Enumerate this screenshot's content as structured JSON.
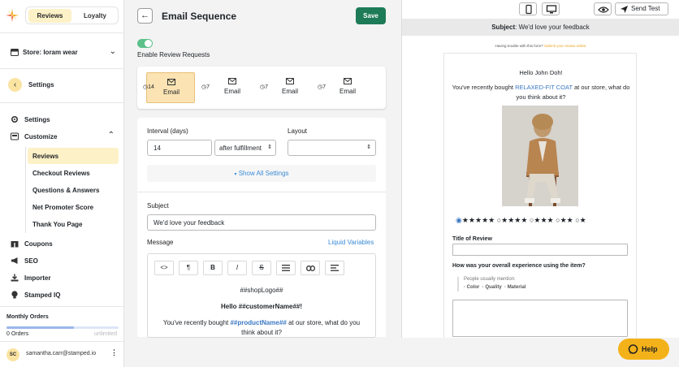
{
  "sidebar": {
    "tabs": [
      {
        "label": "Reviews"
      },
      {
        "label": "Loyalty"
      }
    ],
    "store": "Store: loram wear",
    "settings_back": "Settings",
    "nav": [
      {
        "label": "Settings",
        "icon": "gear-icon"
      },
      {
        "label": "Customize",
        "icon": "customize-icon"
      }
    ],
    "customize_items": [
      {
        "label": "Reviews",
        "active": true
      },
      {
        "label": "Checkout Reviews"
      },
      {
        "label": "Questions & Answers"
      },
      {
        "label": "Net Promoter Score"
      },
      {
        "label": "Thank You Page"
      }
    ],
    "nav2": [
      {
        "label": "Coupons",
        "icon": "gift-icon"
      },
      {
        "label": "SEO",
        "icon": "megaphone-icon"
      },
      {
        "label": "Importer",
        "icon": "import-icon"
      },
      {
        "label": "Stamped IQ",
        "icon": "bulb-icon"
      }
    ],
    "monthly_orders": {
      "title": "Monthly Orders",
      "count": "0 Orders",
      "limit": "unlimited",
      "progress": 0.6
    },
    "user": {
      "initials": "SC",
      "email": "samantha.carr@stamped.io"
    }
  },
  "header": {
    "title": "Email Sequence",
    "save_label": "Save"
  },
  "toggle": {
    "label": "Enable Review Requests",
    "on": true
  },
  "sequence": [
    {
      "days": "14",
      "label": "Email",
      "active": true
    },
    {
      "days": "7",
      "label": "Email"
    },
    {
      "days": "7",
      "label": "Email"
    },
    {
      "days": "7",
      "label": "Email"
    }
  ],
  "settings": {
    "interval_label": "Interval (days)",
    "interval_value": "14",
    "trigger_value": "after fulfillment",
    "layout_label": "Layout",
    "layout_value": "",
    "show_all": "Show All Settings",
    "subject_label": "Subject",
    "subject_value": "We'd love your feedback",
    "message_label": "Message",
    "liquid_vars": "Liquid Variables"
  },
  "editor": {
    "toolbar": [
      "<>",
      "¶",
      "B",
      "I",
      "S",
      "list",
      "link",
      "align"
    ],
    "line1": "##shopLogo##",
    "line2": "Hello ##customerName##!",
    "line3_a": "You've recently bought ",
    "line3_var": "##productName##",
    "line3_b": " at our store, what do you",
    "line4": "think about it?"
  },
  "preview": {
    "send_test": "Send Test",
    "subject_prefix": "Subject",
    "subject": ": We'd love your feedback",
    "trouble_a": "Having trouble with this form? ",
    "trouble_link": "Submit your review online",
    "hello": "Hello John Doh!",
    "bought_a": "You've recently bought ",
    "bought_product": "RELAXED-FIT COAT",
    "bought_b": " at our store, what do",
    "bought_c": "you think about it?",
    "ratings": [
      "★★★★★",
      "★★★★",
      "★★★",
      "★★",
      "★"
    ],
    "title_of_review": "Title of Review",
    "experience_q": "How was your overall experience using the item?",
    "people_mention": "People usually mention:",
    "mentions": [
      "Color",
      "Quality",
      "Material"
    ],
    "accent": "#3a78c2"
  },
  "help": {
    "label": "Help"
  }
}
